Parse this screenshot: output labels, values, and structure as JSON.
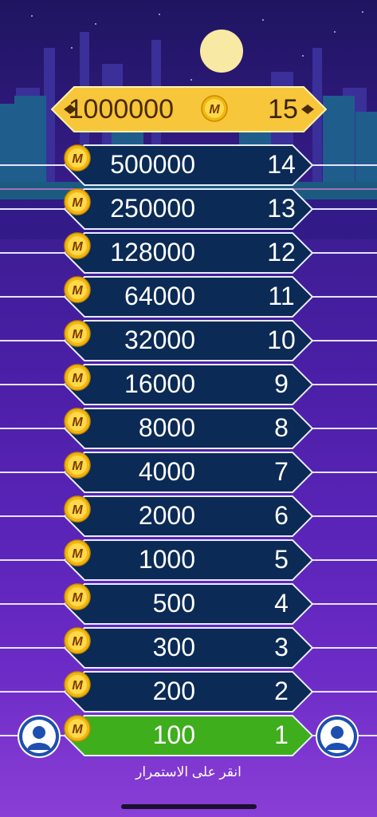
{
  "colors": {
    "normal_pill_fill": "#0b2a55",
    "normal_pill_border": "#e8ecff",
    "top_pill_fill": "#f7c63a",
    "current_pill_fill": "#3fae1d",
    "coin_fill": "#f2b612",
    "coin_letter": "#7a3b00",
    "background_top": "#2a1a7a",
    "background_bottom": "#8a3fd6",
    "moon": "#f8e9a4"
  },
  "coin_letter": "M",
  "ladder": [
    {
      "level": "15",
      "amount": "1000000",
      "style": "top"
    },
    {
      "level": "14",
      "amount": "500000",
      "style": "normal"
    },
    {
      "level": "13",
      "amount": "250000",
      "style": "normal"
    },
    {
      "level": "12",
      "amount": "128000",
      "style": "normal"
    },
    {
      "level": "11",
      "amount": "64000",
      "style": "normal"
    },
    {
      "level": "10",
      "amount": "32000",
      "style": "normal"
    },
    {
      "level": "9",
      "amount": "16000",
      "style": "normal"
    },
    {
      "level": "8",
      "amount": "8000",
      "style": "normal"
    },
    {
      "level": "7",
      "amount": "4000",
      "style": "normal"
    },
    {
      "level": "6",
      "amount": "2000",
      "style": "normal"
    },
    {
      "level": "5",
      "amount": "1000",
      "style": "normal"
    },
    {
      "level": "4",
      "amount": "500",
      "style": "normal"
    },
    {
      "level": "3",
      "amount": "300",
      "style": "normal"
    },
    {
      "level": "2",
      "amount": "200",
      "style": "normal"
    },
    {
      "level": "1",
      "amount": "100",
      "style": "current"
    }
  ],
  "players": [
    {
      "icon": "user-avatar-icon",
      "side": "left"
    },
    {
      "icon": "user-avatar-icon",
      "side": "right"
    }
  ],
  "hint_text": "انقر على الاستمرار"
}
